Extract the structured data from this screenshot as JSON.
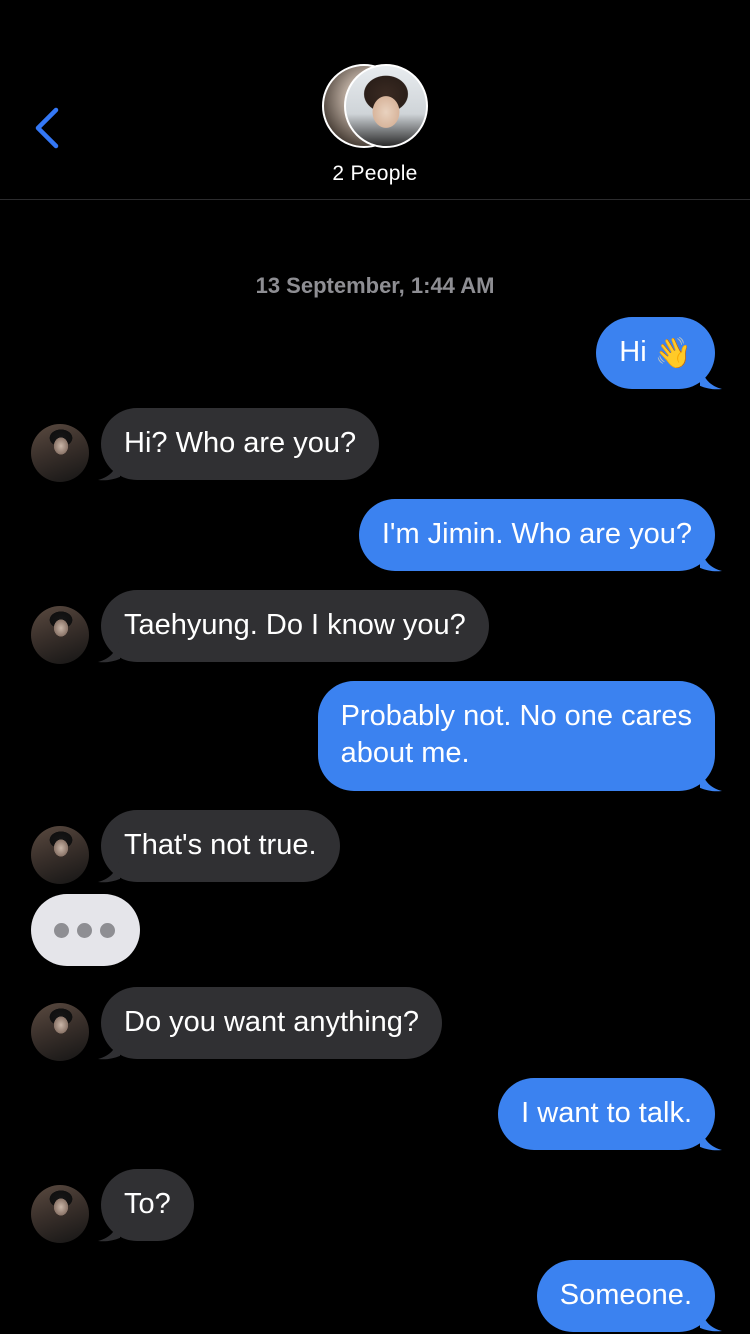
{
  "header": {
    "participants_label": "2 People"
  },
  "thread": {
    "timestamp": "13 September, 1:44 AM",
    "messages": [
      {
        "dir": "out",
        "text": "Hi",
        "emoji": "👋"
      },
      {
        "dir": "in",
        "text": "Hi? Who are you?"
      },
      {
        "dir": "out",
        "text": "I'm Jimin. Who are you?"
      },
      {
        "dir": "in",
        "text": "Taehyung. Do I know you?"
      },
      {
        "dir": "out",
        "line1": "Probably not. No one cares",
        "line2": "about me."
      },
      {
        "dir": "in",
        "text": "That's not true."
      },
      {
        "dir": "in",
        "text": "Do you want anything?"
      },
      {
        "dir": "out",
        "text": "I want to talk."
      },
      {
        "dir": "in",
        "text": "To?"
      },
      {
        "dir": "out",
        "text": "Someone."
      }
    ]
  },
  "colors": {
    "outgoing_bubble": "#3b82f0",
    "incoming_bubble": "#303033",
    "typing_bubble": "#e5e5ea",
    "accent": "#3478f6",
    "timestamp": "#8e8e93"
  },
  "icons": {
    "back": "chevron-left-icon",
    "typing": "typing-indicator"
  }
}
